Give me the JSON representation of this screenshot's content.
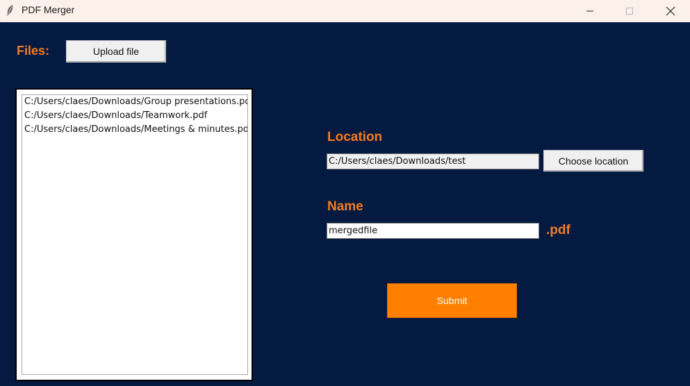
{
  "window": {
    "title": "PDF Merger",
    "icon": "feather-icon"
  },
  "titlebar_buttons": [
    "minimize-icon",
    "maximize-icon",
    "close-icon"
  ],
  "files_section": {
    "label": "Files:",
    "upload_button_label": "Upload file",
    "files": [
      "C:/Users/claes/Downloads/Group presentations.pdf",
      "C:/Users/claes/Downloads/Teamwork.pdf",
      "C:/Users/claes/Downloads/Meetings & minutes.pdf"
    ]
  },
  "location_section": {
    "label": "Location",
    "value": "C:/Users/claes/Downloads/test",
    "choose_button_label": "Choose location"
  },
  "name_section": {
    "label": "Name",
    "value": "mergedfile",
    "extension": ".pdf"
  },
  "submit_button_label": "Submit",
  "colors": {
    "background": "#051a40",
    "accent": "#f47c20",
    "submit": "#ff7f00",
    "titlebar": "#fbf1ea"
  }
}
